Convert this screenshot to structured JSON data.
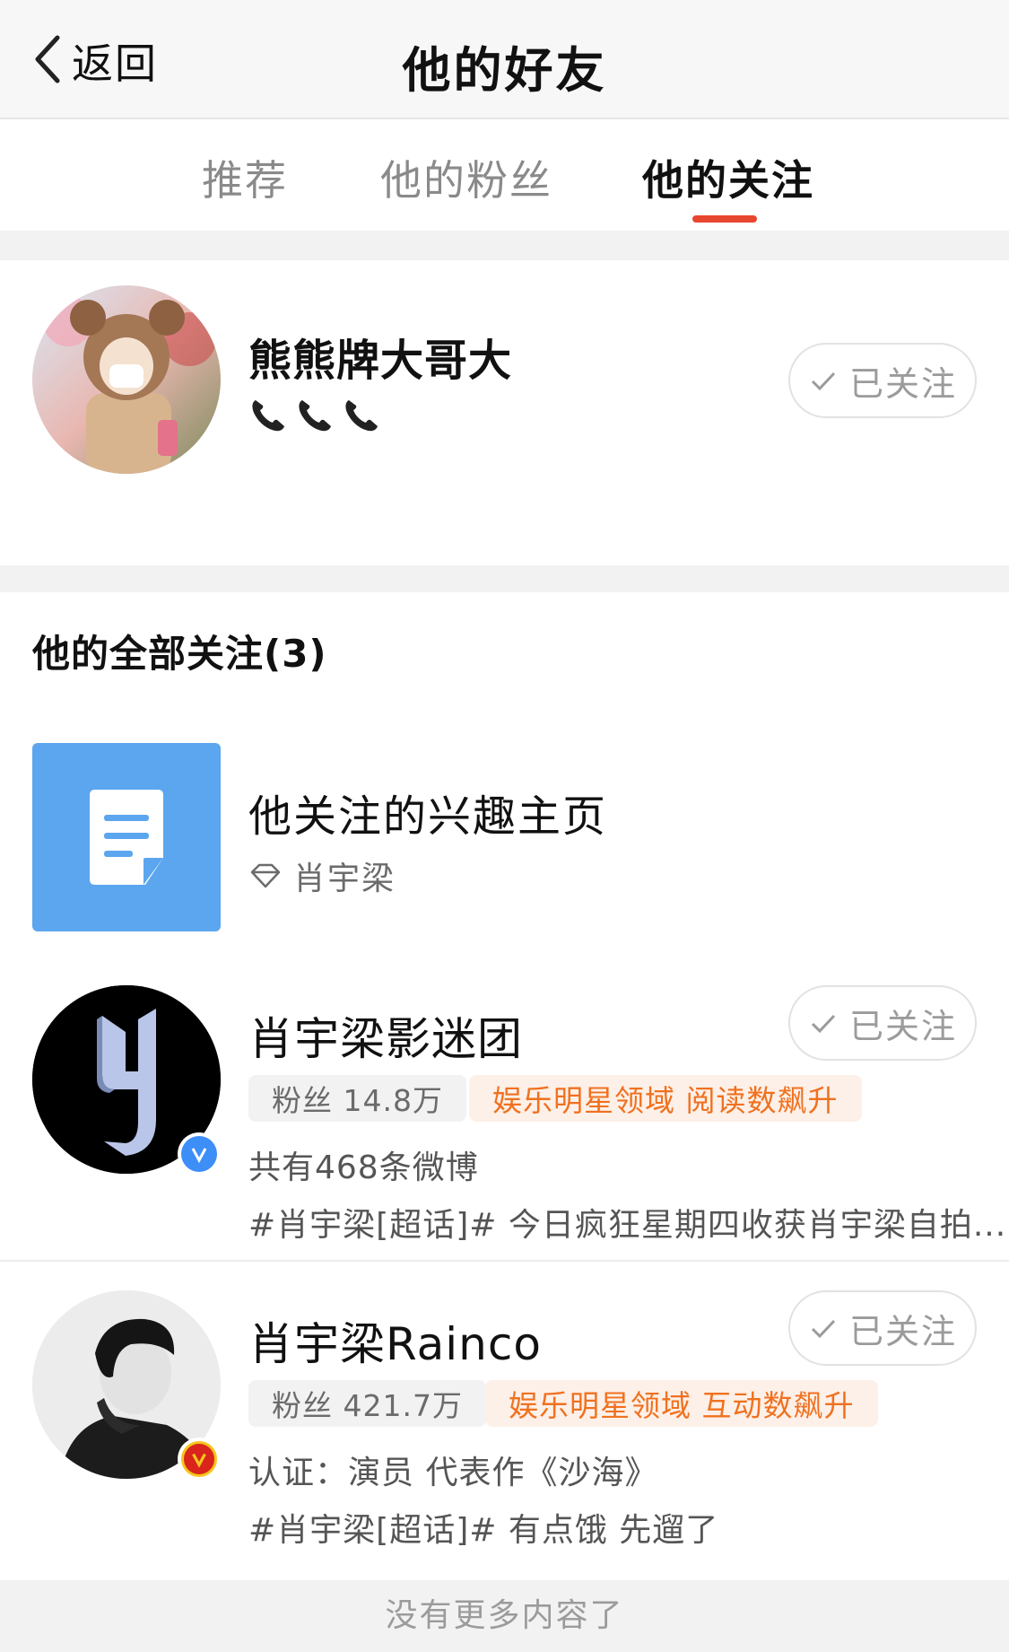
{
  "header": {
    "back_label": "返回",
    "title": "他的好友"
  },
  "tabs": [
    {
      "label": "推荐"
    },
    {
      "label": "他的粉丝"
    },
    {
      "label": "他的关注"
    }
  ],
  "featured": {
    "name": "熊熊牌大哥大",
    "emoji_description": "📞📞📞",
    "follow_label": "已关注"
  },
  "section_title": "他的全部关注(3)",
  "interest": {
    "title": "他关注的兴趣主页",
    "subtitle": "肖宇梁"
  },
  "items": [
    {
      "name": "肖宇梁影迷团",
      "fans": "粉丝 14.8万",
      "tag": "娱乐明星领域 阅读数飙升",
      "line1": "共有468条微博",
      "line2": "#肖宇梁[超话]# 今日疯狂星期四收获肖宇梁自拍...",
      "follow_label": "已关注",
      "badge": "V",
      "badge_color": "#3d8ef7"
    },
    {
      "name": "肖宇梁Rainco",
      "fans": "粉丝 421.7万",
      "tag": "娱乐明星领域 互动数飙升",
      "line1": "认证：演员 代表作《沙海》",
      "line2": "#肖宇梁[超话]# 有点饿 先遛了",
      "follow_label": "已关注",
      "badge": "V",
      "badge_color": "#d9251c"
    }
  ],
  "footer": "没有更多内容了",
  "colors": {
    "accent": "#e8472f",
    "tag_orange": "#f0711f",
    "interest_blue": "#5ba6ee"
  }
}
